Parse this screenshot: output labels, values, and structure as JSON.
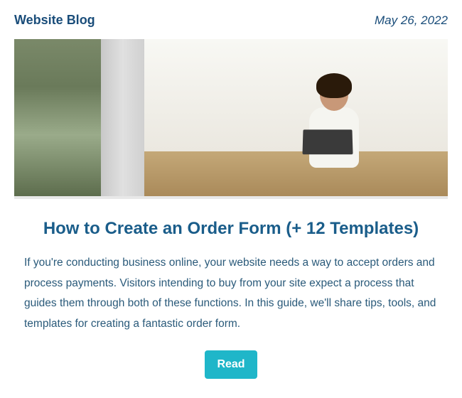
{
  "header": {
    "blog_title": "Website Blog",
    "date": "May 26, 2022"
  },
  "article": {
    "title": "How to Create an Order Form (+ 12 Templates)",
    "body": "If you're conducting business online, your website needs a way to accept orders and process payments. Visitors intending to buy from your site expect a process that guides them through both of these functions. In this guide, we'll share tips, tools, and templates for creating a fantastic order form.",
    "cta_label": "Read"
  }
}
